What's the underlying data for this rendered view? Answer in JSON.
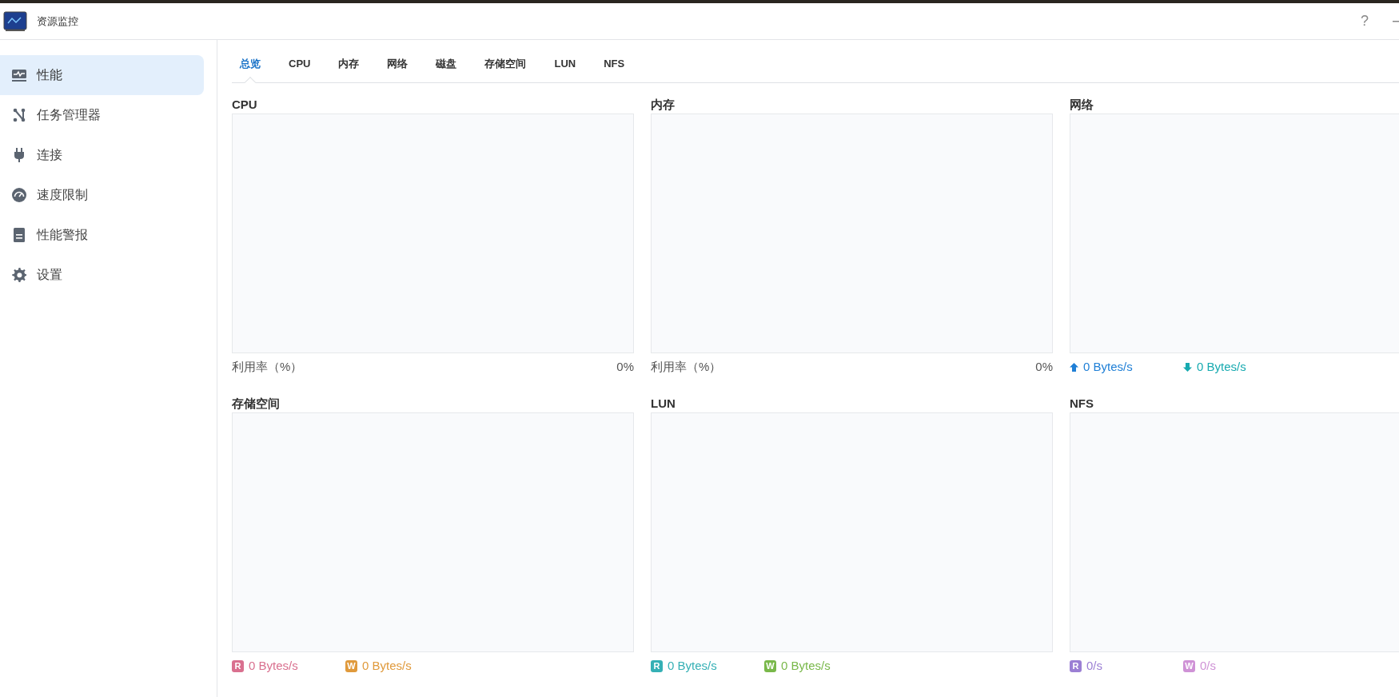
{
  "window": {
    "title": "资源监控",
    "help": "?"
  },
  "sidebar": {
    "items": [
      {
        "label": "性能",
        "selected": true
      },
      {
        "label": "任务管理器",
        "selected": false
      },
      {
        "label": "连接",
        "selected": false
      },
      {
        "label": "速度限制",
        "selected": false
      },
      {
        "label": "性能警报",
        "selected": false
      },
      {
        "label": "设置",
        "selected": false
      }
    ]
  },
  "tabs": [
    {
      "label": "总览",
      "selected": true
    },
    {
      "label": "CPU",
      "selected": false
    },
    {
      "label": "内存",
      "selected": false
    },
    {
      "label": "网络",
      "selected": false
    },
    {
      "label": "磁盘",
      "selected": false
    },
    {
      "label": "存储空间",
      "selected": false
    },
    {
      "label": "LUN",
      "selected": false
    },
    {
      "label": "NFS",
      "selected": false
    }
  ],
  "panels": [
    {
      "title": "CPU",
      "footer": {
        "kind": "usage",
        "label": "利用率（%）",
        "value": "0%"
      }
    },
    {
      "title": "内存",
      "footer": {
        "kind": "usage",
        "label": "利用率（%）",
        "value": "0%"
      }
    },
    {
      "title": "网络",
      "footer": {
        "kind": "rates",
        "items": [
          {
            "kind": "up",
            "text": "0 Bytes/s",
            "color": "#1f7fd6"
          },
          {
            "kind": "down",
            "text": "0 Bytes/s",
            "color": "#17aab0"
          }
        ]
      }
    },
    {
      "title": "存储空间",
      "footer": {
        "kind": "rates",
        "items": [
          {
            "kind": "badge",
            "badge": "R",
            "text": "0 Bytes/s",
            "color": "#d9708f"
          },
          {
            "kind": "badge",
            "badge": "W",
            "text": "0 Bytes/s",
            "color": "#e09a3c"
          }
        ]
      }
    },
    {
      "title": "LUN",
      "footer": {
        "kind": "rates",
        "items": [
          {
            "kind": "badge",
            "badge": "R",
            "text": "0 Bytes/s",
            "color": "#35b0b5"
          },
          {
            "kind": "badge",
            "badge": "W",
            "text": "0 Bytes/s",
            "color": "#79b84a"
          }
        ]
      }
    },
    {
      "title": "NFS",
      "footer": {
        "kind": "rates",
        "items": [
          {
            "kind": "badge",
            "badge": "R",
            "text": "0/s",
            "color": "#9b7fd4"
          },
          {
            "kind": "badge",
            "badge": "W",
            "text": "0/s",
            "color": "#cf92d6"
          }
        ]
      }
    }
  ]
}
